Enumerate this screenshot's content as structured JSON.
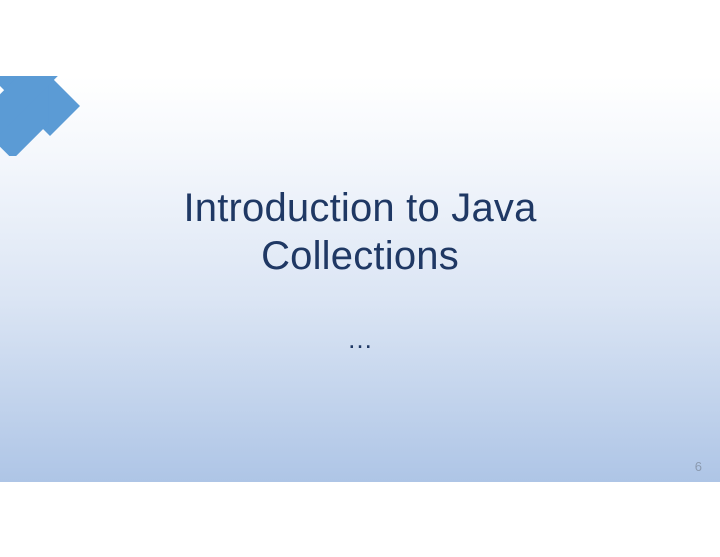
{
  "slide": {
    "title": "Introduction to Java Collections",
    "subtitle": "…",
    "page_number": "6"
  },
  "colors": {
    "title_color": "#1f3864",
    "ribbon_color": "#5b9bd5",
    "gradient_top": "#ffffff",
    "gradient_bottom": "#aec5e6"
  }
}
